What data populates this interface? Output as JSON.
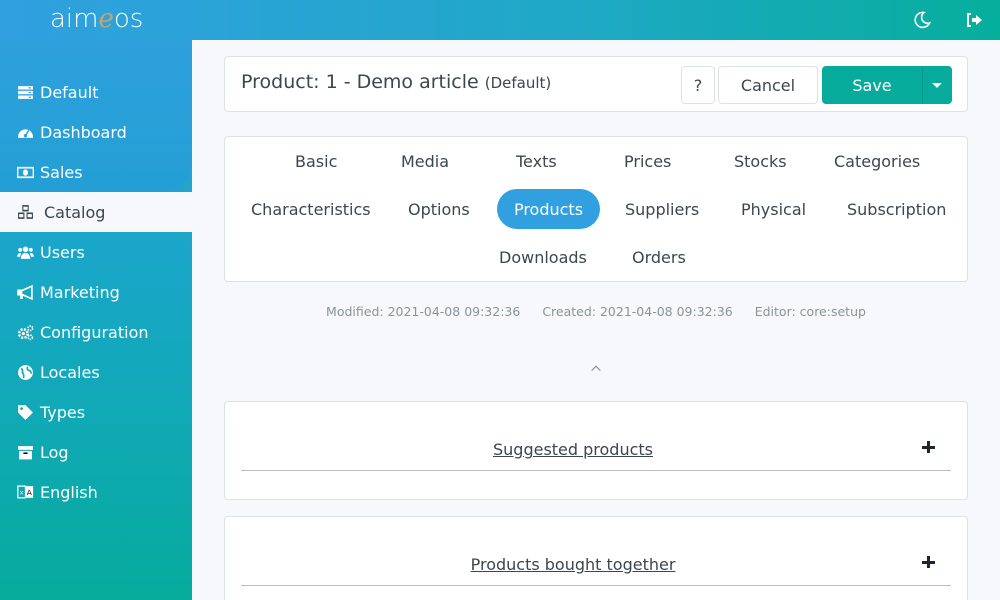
{
  "app": {
    "logo_prefix": "aim",
    "logo_e": "e",
    "logo_suffix": "os",
    "colors": {
      "primary": "#30a0e0",
      "accent": "#06ab9c",
      "logo_e": "#c9a46a"
    }
  },
  "topbar": {
    "icons": [
      "moon-icon",
      "logout-icon"
    ]
  },
  "sidebar": {
    "items": [
      {
        "label": "Default",
        "icon": "server-icon"
      },
      {
        "label": "Dashboard",
        "icon": "tachometer-icon"
      },
      {
        "label": "Sales",
        "icon": "money-bill-icon"
      },
      {
        "label": "Catalog",
        "icon": "cubes-icon",
        "active": true
      },
      {
        "label": "Users",
        "icon": "users-icon"
      },
      {
        "label": "Marketing",
        "icon": "bullhorn-icon"
      },
      {
        "label": "Configuration",
        "icon": "cogs-icon"
      },
      {
        "label": "Locales",
        "icon": "globe-icon"
      },
      {
        "label": "Types",
        "icon": "tag-icon"
      },
      {
        "label": "Log",
        "icon": "archive-icon"
      },
      {
        "label": "English",
        "icon": "language-icon"
      }
    ]
  },
  "header": {
    "title": "Product: 1 - Demo article",
    "site": "(Default)",
    "help_label": "?",
    "cancel_label": "Cancel",
    "save_label": "Save"
  },
  "tabs": [
    {
      "label": "Basic"
    },
    {
      "label": "Media"
    },
    {
      "label": "Texts"
    },
    {
      "label": "Prices"
    },
    {
      "label": "Stocks"
    },
    {
      "label": "Categories"
    },
    {
      "label": "Characteristics"
    },
    {
      "label": "Options"
    },
    {
      "label": "Products",
      "active": true
    },
    {
      "label": "Suppliers"
    },
    {
      "label": "Physical"
    },
    {
      "label": "Subscription"
    },
    {
      "label": "Downloads"
    },
    {
      "label": "Orders"
    }
  ],
  "meta": {
    "modified": "Modified: 2021-04-08 09:32:36",
    "created": "Created: 2021-04-08 09:32:36",
    "editor": "Editor: core:setup"
  },
  "sections": [
    {
      "title": "Suggested products"
    },
    {
      "title": "Products bought together"
    }
  ]
}
